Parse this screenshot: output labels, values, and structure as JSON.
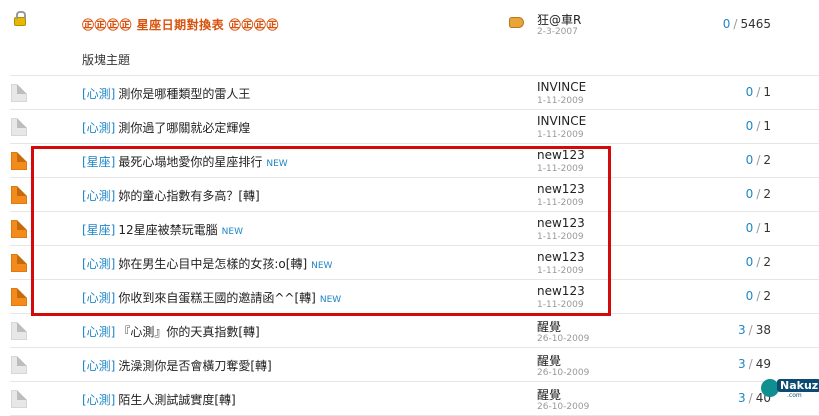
{
  "sticky": {
    "title": "㊣㊣㊣㊣ 星座日期對換表 ㊣㊣㊣㊣",
    "author": "狂@車R",
    "date": "2-3-2007",
    "replies": "0",
    "views": "5465"
  },
  "section_label": "版塊主題",
  "threads": [
    {
      "tag": "[心測]",
      "title": "測你是哪種類型的雷人王",
      "new": "",
      "author": "INVINCE",
      "date": "1-11-2009",
      "replies": "0",
      "views": "1",
      "hot": false
    },
    {
      "tag": "[心測]",
      "title": "測你過了哪關就必定輝煌",
      "new": "",
      "author": "INVINCE",
      "date": "1-11-2009",
      "replies": "0",
      "views": "1",
      "hot": false
    },
    {
      "tag": "[星座]",
      "title": "最死心塌地愛你的星座排行",
      "new": "NEW",
      "author": "new123",
      "date": "1-11-2009",
      "replies": "0",
      "views": "2",
      "hot": true
    },
    {
      "tag": "[心測]",
      "title": "妳的童心指數有多高？[轉]",
      "new": "",
      "author": "new123",
      "date": "1-11-2009",
      "replies": "0",
      "views": "2",
      "hot": true
    },
    {
      "tag": "[星座]",
      "title": "12星座被禁玩電腦",
      "new": "NEW",
      "author": "new123",
      "date": "1-11-2009",
      "replies": "0",
      "views": "1",
      "hot": true
    },
    {
      "tag": "[心測]",
      "title": "妳在男生心目中是怎樣的女孩:o[轉]",
      "new": "NEW",
      "author": "new123",
      "date": "1-11-2009",
      "replies": "0",
      "views": "2",
      "hot": true
    },
    {
      "tag": "[心測]",
      "title": "你收到來自蛋糕王國的邀請函^^[轉]",
      "new": "NEW",
      "author": "new123",
      "date": "1-11-2009",
      "replies": "0",
      "views": "2",
      "hot": true
    },
    {
      "tag": "[心測]",
      "title": "『心測』你的天真指數[轉]",
      "new": "",
      "author": "醒覺",
      "date": "26-10-2009",
      "replies": "3",
      "views": "38",
      "hot": false
    },
    {
      "tag": "[心測]",
      "title": "洗澡測你是否會橫刀奪愛[轉]",
      "new": "",
      "author": "醒覺",
      "date": "26-10-2009",
      "replies": "3",
      "views": "49",
      "hot": false
    },
    {
      "tag": "[心測]",
      "title": "陌生人測試誠實度[轉]",
      "new": "",
      "author": "醒覺",
      "date": "26-10-2009",
      "replies": "3",
      "views": "40",
      "hot": false
    }
  ],
  "separator": "/",
  "watermark": {
    "brand": "Nakuz",
    "sub": ".com"
  },
  "colors": {
    "accent": "#1f85c7",
    "sticky": "#d8520c",
    "highlight": "#d40a0a",
    "hot_icon": "#f28a1c"
  }
}
